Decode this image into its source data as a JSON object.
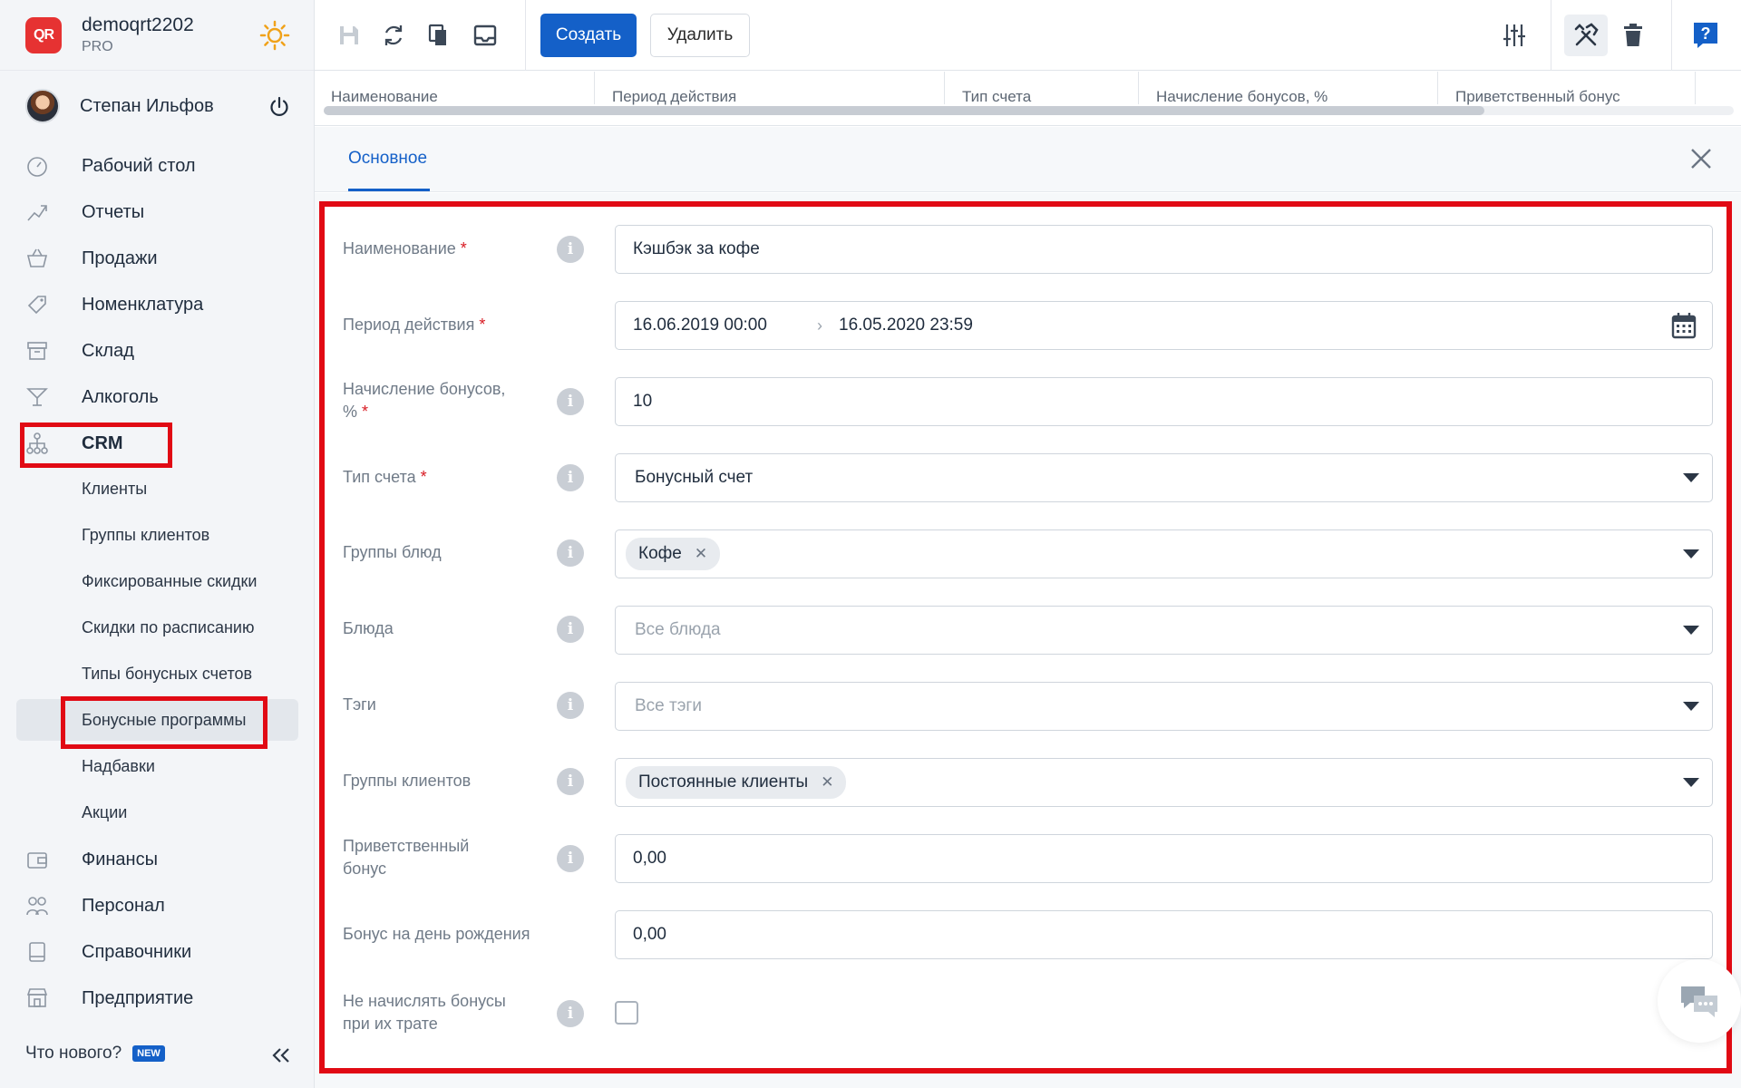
{
  "brand": {
    "name": "demoqrt2202",
    "plan": "PRO",
    "logo_text": "QR"
  },
  "user": {
    "name": "Степан Ильфов"
  },
  "nav": [
    {
      "label": "Рабочий стол",
      "icon": "dashboard-icon"
    },
    {
      "label": "Отчеты",
      "icon": "reports-icon"
    },
    {
      "label": "Продажи",
      "icon": "basket-icon"
    },
    {
      "label": "Номенклатура",
      "icon": "tag-icon"
    },
    {
      "label": "Склад",
      "icon": "warehouse-icon"
    },
    {
      "label": "Алкоголь",
      "icon": "cocktail-icon"
    },
    {
      "label": "CRM",
      "icon": "hierarchy-icon"
    },
    {
      "label": "Финансы",
      "icon": "wallet-icon"
    },
    {
      "label": "Персонал",
      "icon": "people-icon"
    },
    {
      "label": "Справочники",
      "icon": "book-icon"
    },
    {
      "label": "Предприятие",
      "icon": "store-icon"
    }
  ],
  "crm_sub": [
    "Клиенты",
    "Группы клиентов",
    "Фиксированные скидки",
    "Скидки по расписанию",
    "Типы бонусных счетов",
    "Бонусные программы",
    "Надбавки",
    "Акции"
  ],
  "footer": {
    "whats_new": "Что нового?",
    "new_badge": "NEW"
  },
  "toolbar": {
    "create_label": "Создать",
    "delete_label": "Удалить"
  },
  "table_header": [
    "Наименование",
    "Период действия",
    "Тип счета",
    "Начисление бонусов, %",
    "Приветственный бонус"
  ],
  "tabs": {
    "main": "Основное"
  },
  "form": {
    "name": {
      "label": "Наименование",
      "value": "Кэшбэк за кофе"
    },
    "period": {
      "label": "Период действия",
      "start": "16.06.2019 00:00",
      "end": "16.05.2020 23:59"
    },
    "bonus_percent": {
      "label_line1": "Начисление бонусов,",
      "label_line2": "%",
      "value": "10"
    },
    "account_type": {
      "label": "Тип счета",
      "value": "Бонусный счет"
    },
    "dish_groups": {
      "label": "Группы блюд",
      "chip": "Кофе"
    },
    "dishes": {
      "label": "Блюда",
      "placeholder": "Все блюда"
    },
    "tags": {
      "label": "Тэги",
      "placeholder": "Все тэги"
    },
    "client_groups": {
      "label": "Группы клиентов",
      "chip": "Постоянные клиенты"
    },
    "welcome_bonus": {
      "label_line1": "Приветственный",
      "label_line2": "бонус",
      "value": "0,00"
    },
    "birthday_bonus": {
      "label": "Бонус на день рождения",
      "value": "0,00"
    },
    "no_accrual": {
      "label_line1": "Не начислять бонусы",
      "label_line2": "при их трате",
      "checked": false
    }
  },
  "colors": {
    "accent": "#1460c8",
    "highlight": "#e10a14",
    "brand": "#e63232"
  }
}
